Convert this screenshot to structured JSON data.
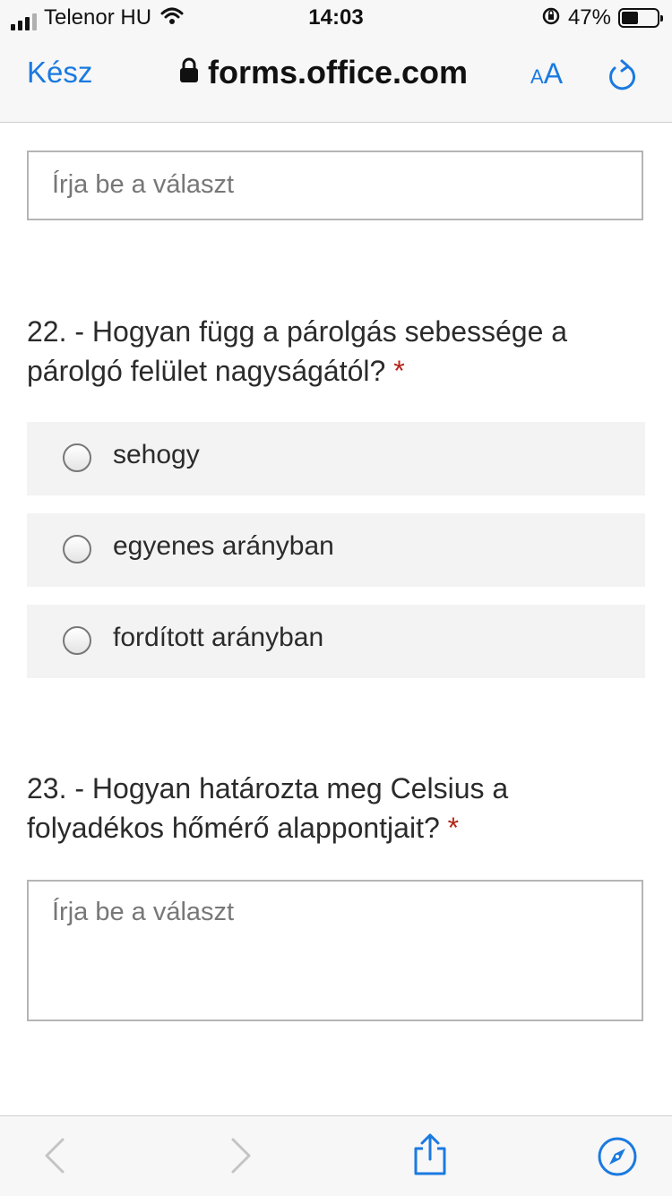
{
  "status_bar": {
    "carrier": "Telenor HU",
    "time": "14:03",
    "battery_percent": "47%",
    "battery_level": 0.47
  },
  "nav": {
    "done_label": "Kész",
    "url": "forms.office.com",
    "text_size_small": "A",
    "text_size_big": "A"
  },
  "form": {
    "answer_placeholder_top": "Írja be a választ",
    "q22": {
      "text": "22. - Hogyan függ a párolgás sebessége a párolgó felület nagyságától?",
      "required_mark": "*",
      "options": [
        "sehogy",
        "egyenes arányban",
        "fordított arányban"
      ]
    },
    "q23": {
      "text": "23. - Hogyan határozta meg Celsius a folyadékos hőmérő alappontjait?",
      "required_mark": "*",
      "answer_placeholder": "Írja be a választ"
    }
  },
  "colors": {
    "accent": "#1a7ae0",
    "required": "#b42318",
    "option_bg": "#f3f3f3"
  },
  "icons": [
    "signal-icon",
    "wifi-icon",
    "rotation-lock-icon",
    "battery-icon",
    "lock-icon",
    "reload-icon",
    "back-icon",
    "forward-icon",
    "share-icon",
    "compass-icon"
  ]
}
